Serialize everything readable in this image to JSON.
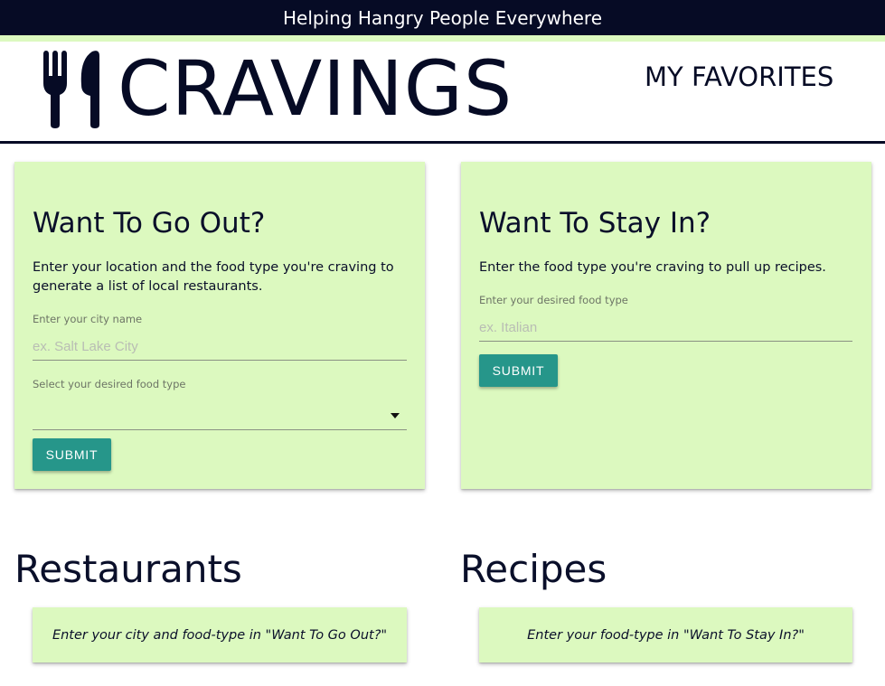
{
  "banner": {
    "tagline": "Helping Hangry People Everywhere"
  },
  "header": {
    "logo_icon": "fork-knife-icon",
    "brand": "CRAVINGS",
    "nav_favorites": "MY FAVORITES"
  },
  "go_out": {
    "title": "Want To Go Out?",
    "description": "Enter your location and the food type you're craving to generate a list of local restaurants.",
    "city_label": "Enter your city name",
    "city_placeholder": "ex. Salt Lake City",
    "city_value": "",
    "food_label": "Select your desired food type",
    "food_selected": "",
    "submit_label": "SUBMIT"
  },
  "stay_in": {
    "title": "Want To Stay In?",
    "description": "Enter the food type you're craving to pull up recipes.",
    "food_label": "Enter your desired food type",
    "food_placeholder": "ex. Italian",
    "food_value": "",
    "submit_label": "SUBMIT"
  },
  "restaurants": {
    "title": "Restaurants",
    "empty_message": "Enter your city and food-type in \"Want To Go Out?\""
  },
  "recipes": {
    "title": "Recipes",
    "empty_message": "Enter your food-type in \"Want To Stay In?\""
  },
  "colors": {
    "navy": "#060b25",
    "light_green": "#dcf9bf",
    "teal": "#26968a"
  }
}
